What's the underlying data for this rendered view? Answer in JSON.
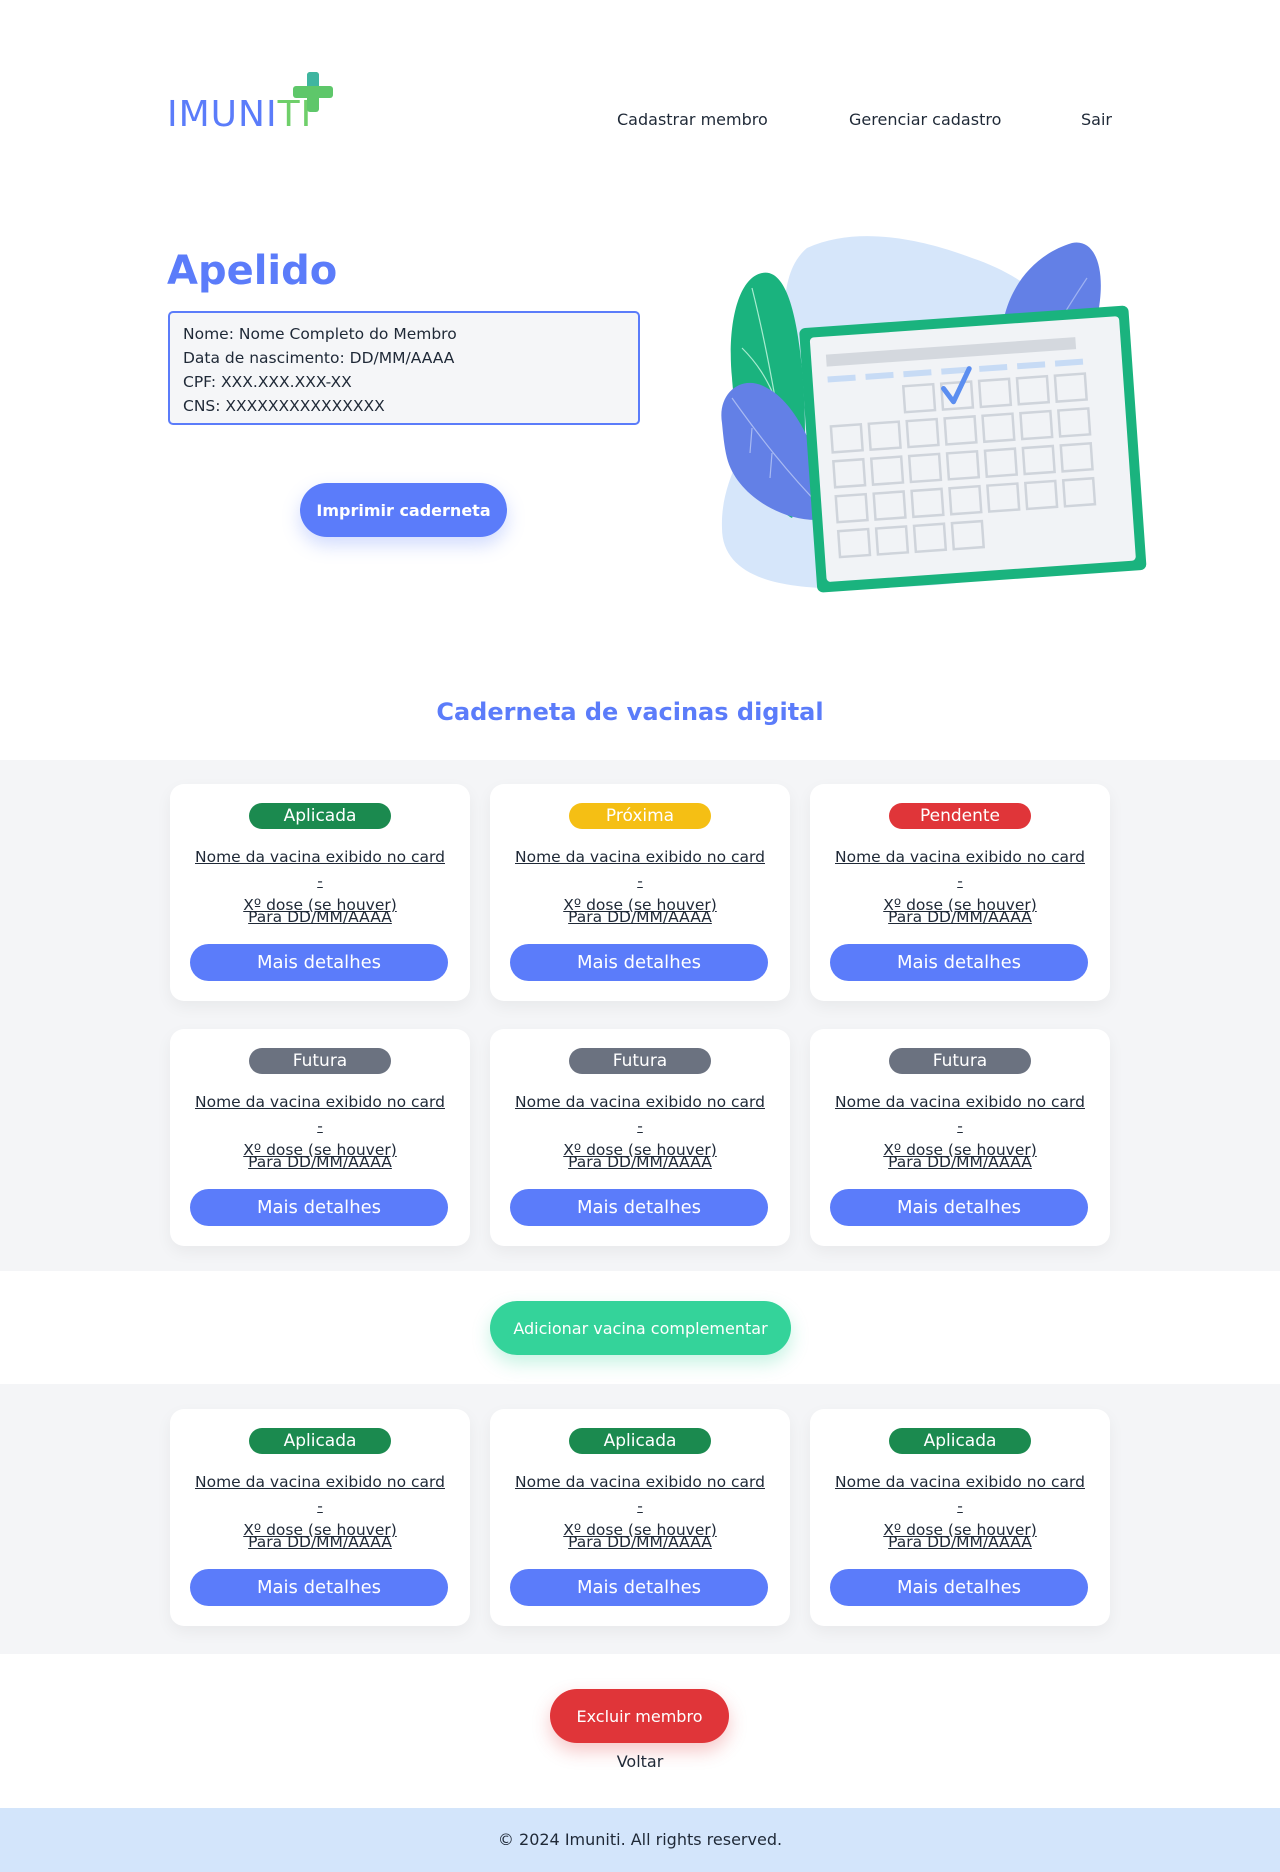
{
  "brand": {
    "logo_main": "IMUNI",
    "logo_accent": "TI",
    "logo_icon": "plus-icon"
  },
  "nav": {
    "items": [
      "Cadastrar membro",
      "Gerenciar cadastro",
      "Sair"
    ]
  },
  "hero": {
    "title": "Apelido",
    "info": [
      "Nome: Nome Completo do Membro",
      "Data de nascimento: DD/MM/AAAA",
      "CPF: XXX.XXX.XXX-XX",
      "CNS: XXXXXXXXXXXXXXX"
    ],
    "print_button": "Imprimir caderneta"
  },
  "section_title": "Caderneta de vacinas digital",
  "status_colors": {
    "Aplicada": "#1b8a4f",
    "Próxima": "#f5bf14",
    "Pendente": "#e03539",
    "Futura": "#6b7280"
  },
  "vaccines": [
    {
      "status": "Aplicada",
      "name_line1": "Nome da vacina exibido no card -",
      "name_line2": "Xº dose (se houver)",
      "date": "Para DD/MM/AAAA",
      "button": "Mais detalhes"
    },
    {
      "status": "Próxima",
      "name_line1": "Nome da vacina exibido no card -",
      "name_line2": "Xº dose (se houver)",
      "date": "Para DD/MM/AAAA",
      "button": "Mais detalhes"
    },
    {
      "status": "Pendente",
      "name_line1": "Nome da vacina exibido no card -",
      "name_line2": "Xº dose (se houver)",
      "date": "Para DD/MM/AAAA",
      "button": "Mais detalhes"
    },
    {
      "status": "Futura",
      "name_line1": "Nome da vacina exibido no card -",
      "name_line2": "Xº dose (se houver)",
      "date": "Para DD/MM/AAAA",
      "button": "Mais detalhes"
    },
    {
      "status": "Futura",
      "name_line1": "Nome da vacina exibido no card -",
      "name_line2": "Xº dose (se houver)",
      "date": "Para DD/MM/AAAA",
      "button": "Mais detalhes"
    },
    {
      "status": "Futura",
      "name_line1": "Nome da vacina exibido no card -",
      "name_line2": "Xº dose (se houver)",
      "date": "Para DD/MM/AAAA",
      "button": "Mais detalhes"
    }
  ],
  "add_button": "Adicionar vacina complementar",
  "complementary": [
    {
      "status": "Aplicada",
      "name_line1": "Nome da vacina exibido no card -",
      "name_line2": "Xº dose (se houver)",
      "date": "Para DD/MM/AAAA",
      "button": "Mais detalhes"
    },
    {
      "status": "Aplicada",
      "name_line1": "Nome da vacina exibido no card -",
      "name_line2": "Xº dose (se houver)",
      "date": "Para DD/MM/AAAA",
      "button": "Mais detalhes"
    },
    {
      "status": "Aplicada",
      "name_line1": "Nome da vacina exibido no card -",
      "name_line2": "Xº dose (se houver)",
      "date": "Para DD/MM/AAAA",
      "button": "Mais detalhes"
    }
  ],
  "delete_button": "Excluir membro",
  "back_link": "Voltar",
  "footer": "© 2024 Imuniti. All rights reserved."
}
